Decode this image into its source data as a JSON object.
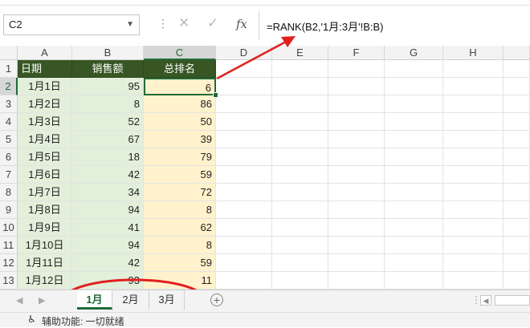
{
  "name_box": "C2",
  "formula_bar": {
    "cancel_icon": "✕",
    "enter_icon": "✓",
    "fx_label": "fx",
    "formula": "=RANK(B2,'1月:3月'!B:B)"
  },
  "columns": [
    "A",
    "B",
    "C",
    "D",
    "E",
    "F",
    "G",
    "H"
  ],
  "rows": [
    "1",
    "2",
    "3",
    "4",
    "5",
    "6",
    "7",
    "8",
    "9",
    "10",
    "11",
    "12",
    "13"
  ],
  "table": {
    "headers": [
      "日期",
      "销售额",
      "总排名"
    ],
    "dates": [
      "1月1日",
      "1月2日",
      "1月3日",
      "1月4日",
      "1月5日",
      "1月6日",
      "1月7日",
      "1月8日",
      "1月9日",
      "1月10日",
      "1月11日",
      "1月12日"
    ],
    "sales": [
      "95",
      "8",
      "52",
      "67",
      "18",
      "42",
      "34",
      "94",
      "41",
      "94",
      "42",
      "93"
    ],
    "ranks": [
      "6",
      "86",
      "50",
      "39",
      "79",
      "59",
      "72",
      "8",
      "62",
      "8",
      "59",
      "11"
    ]
  },
  "sheet_tabs": {
    "nav_prev": "◀",
    "nav_next": "▶",
    "tabs": [
      "1月",
      "2月",
      "3月"
    ],
    "active": "1月",
    "add_icon": "+",
    "more": "⋮"
  },
  "status_bar": {
    "accessibility": "辅助功能: 一切就绪"
  },
  "colors": {
    "header_fill": "#375623",
    "date_fill": "#e2efda",
    "rank_fill": "#fff2cc",
    "annotation": "#e02020",
    "selection": "#1f6b38"
  }
}
